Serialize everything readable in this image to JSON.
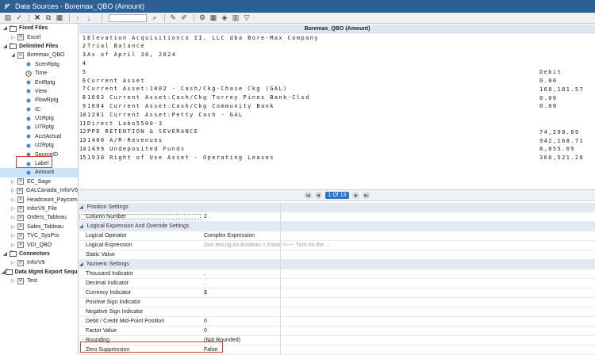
{
  "window": {
    "title": "Data Sources - Boremax_QBO  (Amount)"
  },
  "toolbar": {
    "buttons": [
      "open-icon",
      "run-icon",
      "delete-icon",
      "copy-icon",
      "paste-icon",
      "up-icon",
      "down-icon"
    ],
    "search_placeholder": ""
  },
  "tree": [
    {
      "kind": "group",
      "label": "Fixed Files",
      "twisty": "◢",
      "icon": "folder"
    },
    {
      "kind": "item",
      "indent": 1,
      "label": "Excel",
      "twisty": "▷",
      "icon": "box"
    },
    {
      "kind": "group",
      "label": "Delimited Files",
      "twisty": "◢",
      "icon": "folder"
    },
    {
      "kind": "item",
      "indent": 1,
      "label": "Boremax_QBO",
      "twisty": "◢",
      "icon": "box"
    },
    {
      "kind": "item",
      "indent": 2,
      "label": "ScenRptg",
      "icon": "dot"
    },
    {
      "kind": "item",
      "indent": 2,
      "label": "Time",
      "icon": "clock"
    },
    {
      "kind": "item",
      "indent": 2,
      "label": "EntRptg",
      "icon": "dot"
    },
    {
      "kind": "item",
      "indent": 2,
      "label": "View",
      "icon": "dot"
    },
    {
      "kind": "item",
      "indent": 2,
      "label": "FlowRptg",
      "icon": "dot"
    },
    {
      "kind": "item",
      "indent": 2,
      "label": "IC",
      "icon": "dot"
    },
    {
      "kind": "item",
      "indent": 2,
      "label": "U1Rptg",
      "icon": "dot"
    },
    {
      "kind": "item",
      "indent": 2,
      "label": "U7Rptg",
      "icon": "dot"
    },
    {
      "kind": "item",
      "indent": 2,
      "label": "AcctActual",
      "icon": "dot"
    },
    {
      "kind": "item",
      "indent": 2,
      "label": "U2Rptg",
      "icon": "dot"
    },
    {
      "kind": "item",
      "indent": 2,
      "label": "SourceID",
      "icon": "dot"
    },
    {
      "kind": "item",
      "indent": 2,
      "label": "Label",
      "icon": "dot"
    },
    {
      "kind": "item",
      "indent": 2,
      "label": "Amount",
      "icon": "dot",
      "selected": true
    },
    {
      "kind": "item",
      "indent": 1,
      "label": "EC_Sage",
      "twisty": "▷",
      "icon": "box"
    },
    {
      "kind": "item",
      "indent": 1,
      "label": "GALCanada_InforV6",
      "twisty": "▷",
      "icon": "box"
    },
    {
      "kind": "item",
      "indent": 1,
      "label": "Headcount_Paycom",
      "twisty": "▷",
      "icon": "box"
    },
    {
      "kind": "item",
      "indent": 1,
      "label": "InforV9_File",
      "twisty": "▷",
      "icon": "box"
    },
    {
      "kind": "item",
      "indent": 1,
      "label": "Orders_Tableau",
      "twisty": "▷",
      "icon": "box"
    },
    {
      "kind": "item",
      "indent": 1,
      "label": "Sales_Tableau",
      "twisty": "▷",
      "icon": "box"
    },
    {
      "kind": "item",
      "indent": 1,
      "label": "TVC_SysPro",
      "twisty": "▷",
      "icon": "box"
    },
    {
      "kind": "item",
      "indent": 1,
      "label": "VDI_QBO",
      "twisty": "▷",
      "icon": "box"
    },
    {
      "kind": "group",
      "label": "Connectors",
      "twisty": "◢",
      "icon": "folder"
    },
    {
      "kind": "item",
      "indent": 1,
      "label": "InforV9",
      "twisty": "▷",
      "icon": "box"
    },
    {
      "kind": "group",
      "label": "Data Mgmt Export Seque",
      "twisty": "◢",
      "icon": "folder"
    },
    {
      "kind": "item",
      "indent": 1,
      "label": "Test",
      "twisty": "▷",
      "icon": "box"
    }
  ],
  "panel": {
    "header": "Boremax_QBO  (Amount)"
  },
  "doc_lines": [
    {
      "n": "1",
      "text": "Elevation Acquisitionco II, LLC dba Bore-Max Company",
      "right": ""
    },
    {
      "n": "2",
      "text": "Trial Balance",
      "right": ""
    },
    {
      "n": "3",
      "text": "As of April 30, 2024",
      "right": ""
    },
    {
      "n": "4",
      "text": "",
      "right": ""
    },
    {
      "n": "5",
      "text": "",
      "right": "Debit"
    },
    {
      "n": "6",
      "text": "Current Asset",
      "right": "0.00"
    },
    {
      "n": "7",
      "text": "Current Asset:1002 - Cash/Ckg-Chase Ckg (GAL)",
      "right": "168,181.57"
    },
    {
      "n": "8",
      "text": "1003 Current Asset:Cash/Ckg Torrey Pines Bank-Clsd",
      "right": "0.00"
    },
    {
      "n": "9",
      "text": "1004 Current Asset:Cash/Ckg Community Bank",
      "right": "0.00"
    },
    {
      "n": "10",
      "text": "1201 Current Asset:Petty Cash - GAL",
      "right": ""
    },
    {
      "n": "11",
      "text": "Direct Labo5500-3",
      "right": ""
    },
    {
      "n": "12",
      "text": "PPD RETENTION & SEVERANCE",
      "right": "74,298.69"
    },
    {
      "n": "13",
      "text": "1400 A/R-Revenues",
      "right": "942,168.71"
    },
    {
      "n": "14",
      "text": "1499 Undeposited Funds",
      "right": "8,055.69"
    },
    {
      "n": "15",
      "text": "1930 Right of Use Asset - Operating Leases",
      "right": "360,521.20"
    }
  ],
  "pager": {
    "label": "1 Of 13"
  },
  "properties": [
    {
      "section": "Position Settings"
    },
    {
      "key": "Column Number",
      "value": "2",
      "boxed": true
    },
    {
      "section": "Logical Expression And Override Settings"
    },
    {
      "key": "Logical Operator",
      "value": "Complex Expression"
    },
    {
      "key": "Logical Expression",
      "value": "Dim errLog As Boolean = False '<----  Turn on the ...",
      "muted": true
    },
    {
      "key": "Static Value",
      "value": ""
    },
    {
      "section": "Numeric Settings"
    },
    {
      "key": "Thousand Indicator",
      "value": ","
    },
    {
      "key": "Decimal Indicator",
      "value": "."
    },
    {
      "key": "Currency Indicator",
      "value": "$"
    },
    {
      "key": "Positive Sign Indicator",
      "value": ""
    },
    {
      "key": "Negative Sign Indicator",
      "value": ""
    },
    {
      "key": "Debit / Credit Mid-Point Position",
      "value": "0"
    },
    {
      "key": "Factor Value",
      "value": "0"
    },
    {
      "key": "Rounding",
      "value": "(Not Rounded)"
    },
    {
      "key": "Zero Suppression",
      "value": "False"
    }
  ],
  "colors": {
    "titlebar": "#2c5f94",
    "highlight_box": "#e03a3a",
    "selected_bg": "#cce4f7"
  }
}
